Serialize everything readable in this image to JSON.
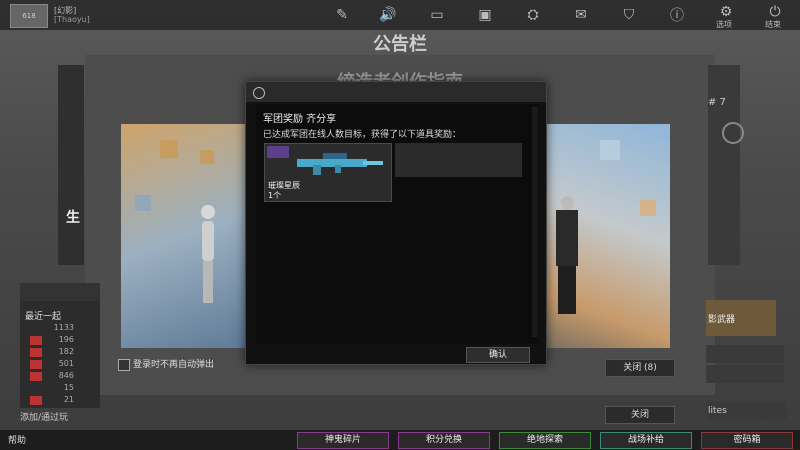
{
  "topbar": {
    "user_name": "[幻影]",
    "user_id": "[Thaoyu]",
    "avatar_label": "618",
    "icons": [
      {
        "name": "edit-icon",
        "glyph": "✎"
      },
      {
        "name": "volume-icon",
        "glyph": "🔊"
      },
      {
        "name": "tv-icon",
        "glyph": "▭"
      },
      {
        "name": "bag-icon",
        "glyph": "▣"
      },
      {
        "name": "controller-icon",
        "glyph": "⛭"
      },
      {
        "name": "ticket-icon",
        "glyph": "✉"
      },
      {
        "name": "shield-icon",
        "glyph": "⛉"
      },
      {
        "name": "alert-icon",
        "glyph": "ⓘ"
      },
      {
        "name": "settings-icon",
        "glyph": "⚙"
      },
      {
        "name": "power-icon",
        "glyph": "⏻"
      }
    ],
    "settings_label": "选项",
    "exit_label": "结束"
  },
  "board": {
    "title": "公告栏",
    "subtitle": "缔造者创作指南",
    "left_big_char": "生",
    "right_num": "# 7",
    "close_label": "关闭 (8)",
    "close2_label": "关闭",
    "checkbox_label": "登录时不再自动弹出"
  },
  "left_panel": {
    "recent_label": "最近一起",
    "rows": [
      "1133",
      "196",
      "182",
      "501",
      "846",
      "15",
      "21"
    ]
  },
  "right_panel": {
    "weapon_label": "影武器",
    "elites_label": "lites"
  },
  "bottom": {
    "help_label": "帮助",
    "add_label": "添加/通过玩",
    "tabs": [
      "神鬼碎片",
      "积分兑换",
      "绝地探索",
      "战场补给",
      "密码箱"
    ]
  },
  "modal": {
    "title": "军团奖励  齐分享",
    "message": "已达成军团在线人数目标，获得了以下道具奖励：",
    "item_name": "璀璨星辰",
    "item_count": "1个",
    "confirm_label": "确认"
  },
  "colors": {
    "accent_purple": "#5b3f8a",
    "tab_border": "#8a3a8a"
  }
}
